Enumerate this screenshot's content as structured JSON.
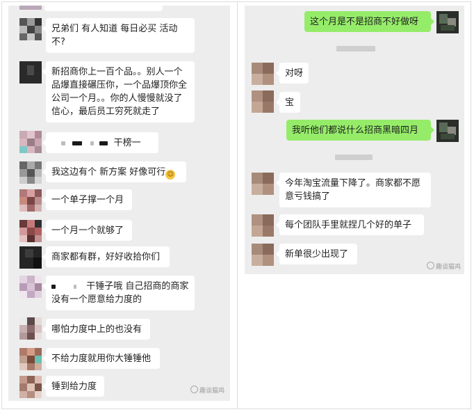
{
  "left_chat": {
    "messages": [
      {
        "text": "兄弟们   有人知道 每日必买 活动不?"
      },
      {
        "text": "新招商你上一百个品。。别人一个品爆直接碾压你，一个品爆顶你全公司一个月。。你的人慢慢就没了信心，最后员工穷死就走了"
      },
      {
        "text": "干榜一"
      },
      {
        "text": "我这边有个 新方案  好像可行"
      },
      {
        "text": "一个单子撑一个月"
      },
      {
        "text": "一个月一个就够了"
      },
      {
        "text": "商家都有群，好好收拾你们"
      },
      {
        "text_line1": "干锤子哦  自己招商的商家",
        "text_line2": "没有一个愿意给力度的"
      },
      {
        "text": "哪怕力度中上的也没有"
      },
      {
        "text": "不给力度就用你大锤锤他"
      },
      {
        "text": "锤到给力度"
      }
    ],
    "watermark": "趣谈猫鸡"
  },
  "right_chat": {
    "messages": [
      {
        "text": "这个月是不是招商不好做呀",
        "sender": "self"
      },
      {
        "text": "对呀",
        "sender": "other"
      },
      {
        "text": "宝",
        "sender": "other"
      },
      {
        "text": "我听他们都说什么招商黑暗四月",
        "sender": "self"
      },
      {
        "text": "今年淘宝流量下降了。商家都不愿意亏钱搞了",
        "sender": "other"
      },
      {
        "text": "每个团队手里就捏几个好的单子",
        "sender": "other"
      },
      {
        "text": "新单很少出现了",
        "sender": "other"
      }
    ],
    "watermark": "趣谈猫鸡"
  },
  "colors": {
    "bubble_self": "#95ec69",
    "bubble_other": "#ffffff",
    "chat_bg": "#ededed"
  }
}
